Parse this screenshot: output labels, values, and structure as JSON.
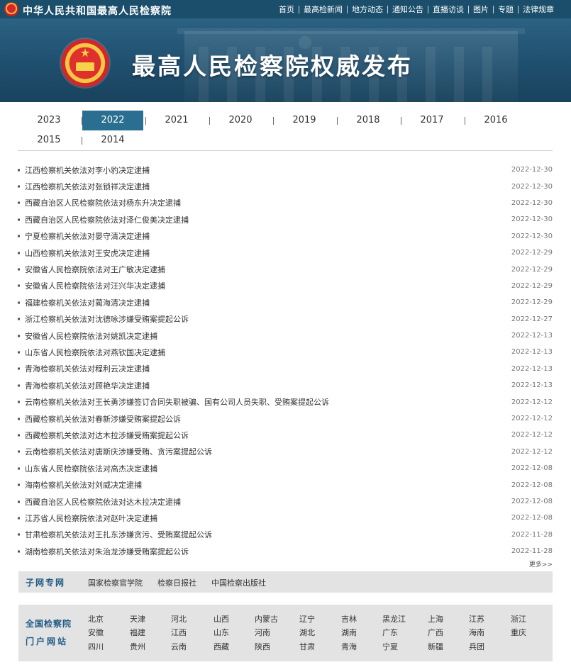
{
  "header": {
    "site_name": "中华人民共和国最高人民检察院",
    "nav": [
      "首页",
      "最高检新闻",
      "地方动态",
      "通知公告",
      "直播访谈",
      "图片",
      "专题",
      "法律规章"
    ]
  },
  "banner": {
    "title": "最高人民检察院权威发布"
  },
  "year_tabs": {
    "items": [
      "2023",
      "2022",
      "2021",
      "2020",
      "2019",
      "2018",
      "2017",
      "2016",
      "2015",
      "2014"
    ],
    "active": "2022"
  },
  "news": [
    {
      "title": "江西检察机关依法对李小豹决定逮捕",
      "date": "2022-12-30"
    },
    {
      "title": "江西检察机关依法对张锁祥决定逮捕",
      "date": "2022-12-30"
    },
    {
      "title": "西藏自治区人民检察院依法对杨东升决定逮捕",
      "date": "2022-12-30"
    },
    {
      "title": "西藏自治区人民检察院依法对泽仁俊美决定逮捕",
      "date": "2022-12-30"
    },
    {
      "title": "宁夏检察机关依法对晏守清决定逮捕",
      "date": "2022-12-30"
    },
    {
      "title": "山西检察机关依法对王安虎决定逮捕",
      "date": "2022-12-29"
    },
    {
      "title": "安徽省人民检察院依法对王广敏决定逮捕",
      "date": "2022-12-29"
    },
    {
      "title": "安徽省人民检察院依法对汪兴华决定逮捕",
      "date": "2022-12-29"
    },
    {
      "title": "福建检察机关依法对蔺海清决定逮捕",
      "date": "2022-12-29"
    },
    {
      "title": "浙江检察机关依法对沈德咏涉嫌受贿案提起公诉",
      "date": "2022-12-27"
    },
    {
      "title": "安徽省人民检察院依法对姚凯决定逮捕",
      "date": "2022-12-13"
    },
    {
      "title": "山东省人民检察院依法对燕钦国决定逮捕",
      "date": "2022-12-13"
    },
    {
      "title": "青海检察机关依法对程利云决定逮捕",
      "date": "2022-12-13"
    },
    {
      "title": "青海检察机关依法对顾艳华决定逮捕",
      "date": "2022-12-13"
    },
    {
      "title": "云南检察机关依法对王长勇涉嫌签订合同失职被骗、国有公司人员失职、受贿案提起公诉",
      "date": "2022-12-12"
    },
    {
      "title": "西藏检察机关依法对春新涉嫌受贿案提起公诉",
      "date": "2022-12-12"
    },
    {
      "title": "西藏检察机关依法对达木拉涉嫌受贿案提起公诉",
      "date": "2022-12-12"
    },
    {
      "title": "云南检察机关依法对唐斯庆涉嫌受贿、贪污案提起公诉",
      "date": "2022-12-12"
    },
    {
      "title": "山东省人民检察院依法对高杰决定逮捕",
      "date": "2022-12-08"
    },
    {
      "title": "海南检察机关依法对刘威决定逮捕",
      "date": "2022-12-08"
    },
    {
      "title": "西藏自治区人民检察院依法对达木拉决定逮捕",
      "date": "2022-12-08"
    },
    {
      "title": "江苏省人民检察院依法对赵叶决定逮捕",
      "date": "2022-12-08"
    },
    {
      "title": "甘肃检察机关依法对王扎东涉嫌贪污、受贿案提起公诉",
      "date": "2022-11-28"
    },
    {
      "title": "湖南检察机关依法对朱治龙涉嫌受贿案提起公诉",
      "date": "2022-11-28"
    }
  ],
  "more_label": "更多>>",
  "subsites": {
    "label": "子网专网",
    "links": [
      "国家检察官学院",
      "检察日报社",
      "中国检察出版社"
    ]
  },
  "portal": {
    "label_line1": "全国检察院",
    "label_line2": "门户网站",
    "rows": [
      [
        "北京",
        "天津",
        "河北",
        "山西",
        "内蒙古",
        "辽宁",
        "吉林",
        "黑龙江",
        "上海",
        "江苏",
        "浙江"
      ],
      [
        "安徽",
        "福建",
        "江西",
        "山东",
        "河南",
        "湖北",
        "湖南",
        "广东",
        "广西",
        "海南",
        "重庆"
      ],
      [
        "四川",
        "贵州",
        "云南",
        "西藏",
        "陕西",
        "甘肃",
        "青海",
        "宁夏",
        "新疆",
        "兵团"
      ]
    ]
  }
}
